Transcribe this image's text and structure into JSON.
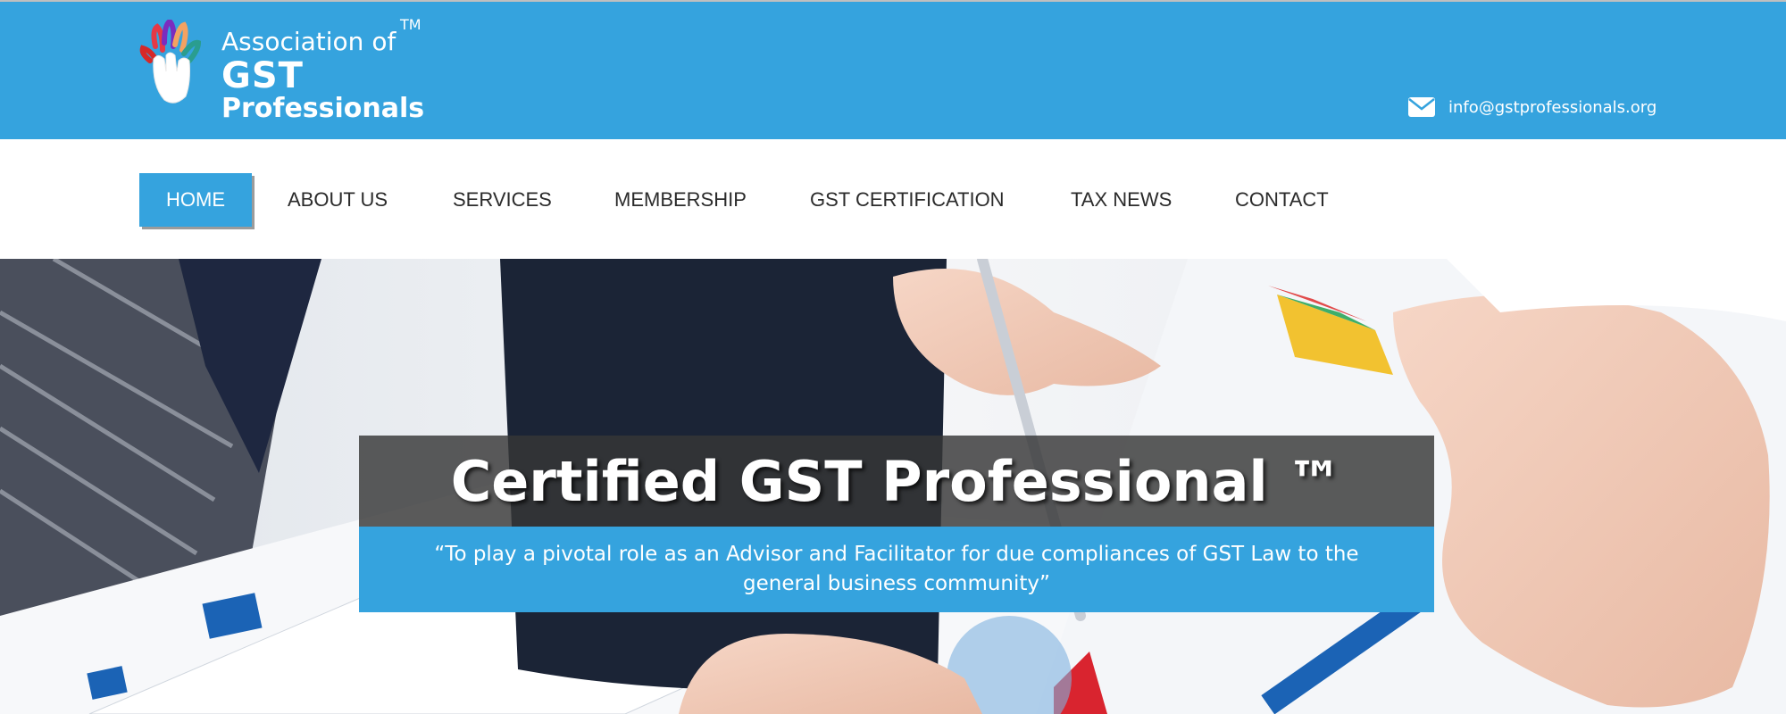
{
  "header": {
    "logo": {
      "line1": "Association of",
      "tm": "TM",
      "line2": "GST",
      "line3": "Professionals"
    },
    "email": "info@gstprofessionals.org",
    "email_icon": "envelope-icon",
    "background_color": "#35a3de"
  },
  "nav": {
    "items": [
      {
        "label": "HOME",
        "active": true
      },
      {
        "label": "ABOUT US",
        "active": false
      },
      {
        "label": "SERVICES",
        "active": false
      },
      {
        "label": "MEMBERSHIP",
        "active": false
      },
      {
        "label": "GST CERTIFICATION",
        "active": false
      },
      {
        "label": "TAX NEWS",
        "active": false
      },
      {
        "label": "CONTACT",
        "active": false
      }
    ],
    "active_color": "#35a3de"
  },
  "hero": {
    "title": "Certified GST Professional ™",
    "subtitle": "“To play a pivotal role as an Advisor and Facilitator for due compliances of GST Law to the general business community”"
  }
}
